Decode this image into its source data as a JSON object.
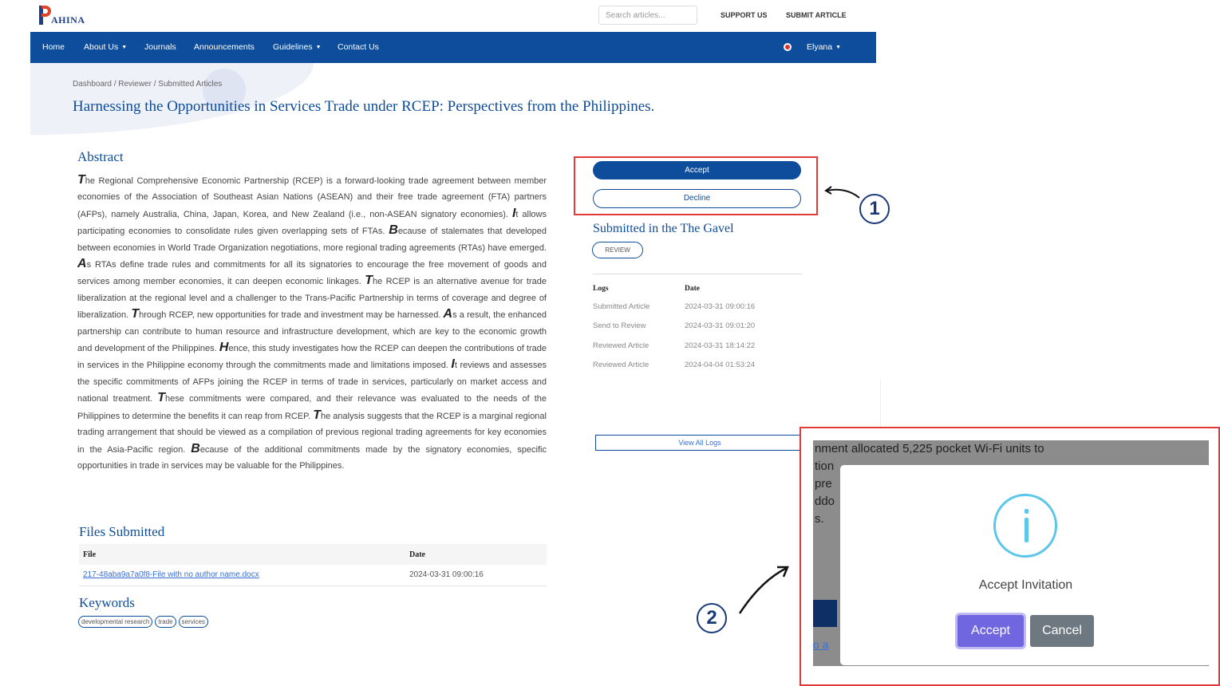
{
  "brand": {
    "logo_text": "AHINA"
  },
  "header": {
    "search_placeholder": "Search articles...",
    "support_label": "SUPPORT US",
    "submit_label": "SUBMIT ARTICLE"
  },
  "nav": {
    "home": "Home",
    "about": "About Us",
    "journals": "Journals",
    "announcements": "Announcements",
    "guidelines": "Guidelines",
    "contact": "Contact Us",
    "user": "Elyana"
  },
  "breadcrumb": "Dashboard / Reviewer / Submitted Articles",
  "article": {
    "title": "Harnessing the Opportunities in Services Trade under RCEP: Perspectives from the Philippines.",
    "abstract_heading": "Abstract",
    "abstract_sentences": [
      "The Regional Comprehensive Economic Partnership (RCEP) is a forward-looking trade agreement between member economies of the Association of Southeast Asian Nations (ASEAN) and their free trade agreement (FTA) partners (AFPs), namely Australia, China, Japan, Korea, and New Zealand (i.e., non-ASEAN signatory economies).",
      "It allows participating economies to consolidate rules given overlapping sets of FTAs.",
      "Because of stalemates that developed between economies in World Trade Organization negotiations, more regional trading agreements (RTAs) have emerged.",
      "As RTAs define trade rules and commitments for all its signatories to encourage the free movement of goods and services among member economies, it can deepen economic linkages.",
      "The RCEP is an alternative avenue for trade liberalization at the regional level and a challenger to the Trans-Pacific Partnership in terms of coverage and degree of liberalization.",
      "Through RCEP, new opportunities for trade and investment may be harnessed.",
      "As a result, the enhanced partnership can contribute to human resource and infrastructure development, which are key to the economic growth and development of the Philippines.",
      "Hence, this study investigates how the RCEP can deepen the contributions of trade in services in the Philippine economy through the commitments made and limitations imposed.",
      "It reviews and assesses the specific commitments of AFPs joining the RCEP in terms of trade in services, particularly on market access and national treatment.",
      "These commitments were compared, and their relevance was evaluated to the needs of the Philippines to determine the benefits it can reap from RCEP.",
      "The analysis suggests that the RCEP is a marginal regional trading arrangement that should be viewed as a compilation of previous regional trading agreements for key economies in the Asia-Pacific region.",
      "Because of the additional commitments made by the signatory economies, specific opportunities in trade in services may be valuable for the Philippines."
    ],
    "files_heading": "Files Submitted",
    "files_columns": [
      "File",
      "Date"
    ],
    "files": [
      {
        "name": "217-48aba9a7a0f8-File with no author name.docx",
        "date": "2024-03-31 09:00:16"
      }
    ],
    "keywords_heading": "Keywords",
    "keywords": [
      "developmental research",
      "trade",
      "services"
    ]
  },
  "review_panel": {
    "accept_label": "Accept",
    "decline_label": "Decline",
    "submitted_in": "Submitted in the The Gavel",
    "status_pill": "REVIEW",
    "logs_columns": [
      "Logs",
      "Date"
    ],
    "logs": [
      {
        "event": "Submitted Article",
        "date": "2024-03-31 09:00:16"
      },
      {
        "event": "Send to Review",
        "date": "2024-03-31 09:01:20"
      },
      {
        "event": "Reviewed Article",
        "date": "2024-03-31 18:14:22"
      },
      {
        "event": "Reviewed Article",
        "date": "2024-04-04 01:53:24"
      }
    ],
    "view_all_logs": "View All Logs"
  },
  "annotations": {
    "step1": "1",
    "step2": "2"
  },
  "modal": {
    "background_lines": [
      "nment allocated 5,225 pocket Wi-Fi units to",
      "tion",
      "pre",
      "ddo",
      "s."
    ],
    "background_link": "o a",
    "icon": "info-icon",
    "title": "Accept Invitation",
    "accept_label": "Accept",
    "cancel_label": "Cancel"
  },
  "colors": {
    "navbar": "#0e4d9b",
    "annotation_red": "#e03a3a",
    "modal_accept": "#7066e0",
    "modal_cancel": "#6e7881",
    "info": "#5bc6ea"
  }
}
